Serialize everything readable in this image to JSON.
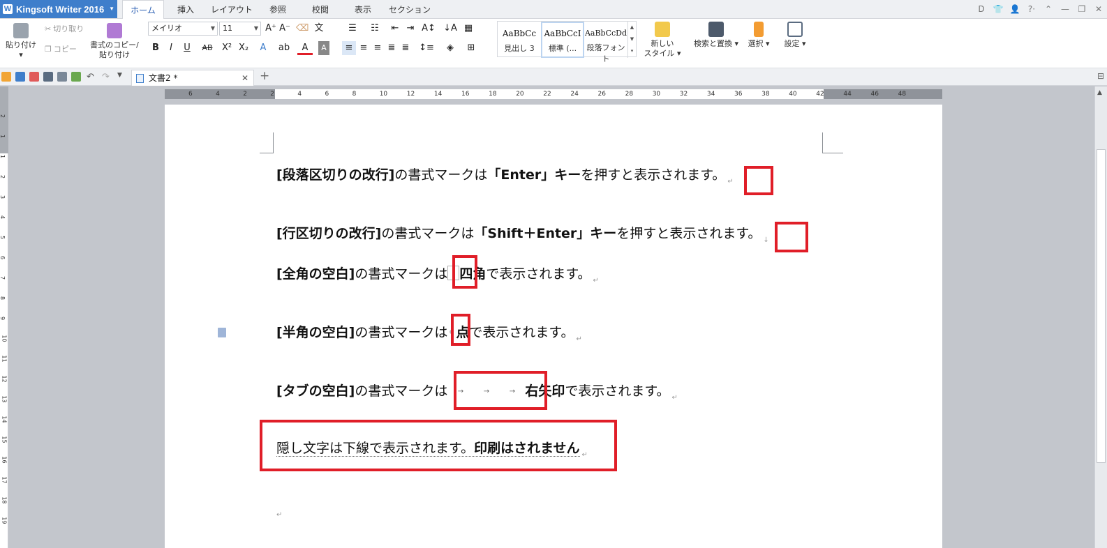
{
  "app": {
    "title": "Kingsoft Writer 2016",
    "tabs": [
      "ホーム",
      "挿入",
      "レイアウト",
      "参照",
      "校閲",
      "表示",
      "セクション"
    ],
    "active_tab": "ホーム",
    "window_controls": [
      "D",
      "👕",
      "👤",
      "?·",
      "⌃",
      "—",
      "❐",
      "✕"
    ]
  },
  "ribbon": {
    "paste": "貼り付け",
    "cut": "切り取り",
    "copy": "コピー",
    "format_painter_line1": "書式のコピー/",
    "format_painter_line2": "貼り付け",
    "font_name": "メイリオ",
    "font_size": "11",
    "styles": [
      {
        "preview": "AaBbCc",
        "name": "見出し 3"
      },
      {
        "preview": "AaBbCcI",
        "name": "標準 (..."
      },
      {
        "preview": "AaBbCcDd",
        "name": "段落フォント"
      }
    ],
    "new_style_line1": "新しい",
    "new_style_line2": "スタイル",
    "find_replace": "検索と置換",
    "select": "選択",
    "settings": "設定"
  },
  "doc_tab": {
    "name": "文書2 *",
    "close": "✕",
    "new": "+"
  },
  "ruler": {
    "h_labels": [
      "6",
      "4",
      "2",
      "2",
      "4",
      "6",
      "8",
      "10",
      "12",
      "14",
      "16",
      "18",
      "20",
      "22",
      "24",
      "26",
      "28",
      "30",
      "32",
      "34",
      "36",
      "38",
      "40",
      "42",
      "44",
      "46",
      "48"
    ],
    "v_labels": [
      "2",
      "1",
      "1",
      "2",
      "3",
      "4",
      "5",
      "6",
      "7",
      "8",
      "9",
      "10",
      "11",
      "12",
      "13",
      "14",
      "15",
      "16",
      "17",
      "18",
      "19"
    ]
  },
  "document": {
    "p1": {
      "bold1": "[段落区切りの改行]",
      "t1": "の書式マークは",
      "bold2": "「Enter」キー",
      "t2": "を押すと表示されます。",
      "mark": "↵"
    },
    "p2": {
      "bold1": "[行区切りの改行]",
      "t1": "の書式マークは",
      "bold2": "「Shift＋Enter」キー",
      "t2": "を押すと表示されます。",
      "mark": "↓"
    },
    "p3": {
      "bold1": "[全角の空白]",
      "t1": "の書式マークは",
      "bold2": "四角",
      "t2": "で表示されます。",
      "mark": "↵"
    },
    "p4": {
      "bold1": "[半角の空白]",
      "t1": "の書式マークは",
      "bold2": "点",
      "t2": "で表示されます。",
      "mark": "↵"
    },
    "p5": {
      "bold1": "[タブの空白]",
      "t1": "の書式マークは",
      "arrow": "→",
      "bold2": "右矢印",
      "t2": "で表示されます。",
      "mark": "↵"
    },
    "p6": {
      "t1": "隠し文字は下線で表示されます。",
      "bold1": "印刷はされません",
      "mark": "↵"
    },
    "p7": {
      "mark": "↵"
    }
  },
  "colors": {
    "accent": "#3e7ecb",
    "highlight": "#e01e28"
  }
}
